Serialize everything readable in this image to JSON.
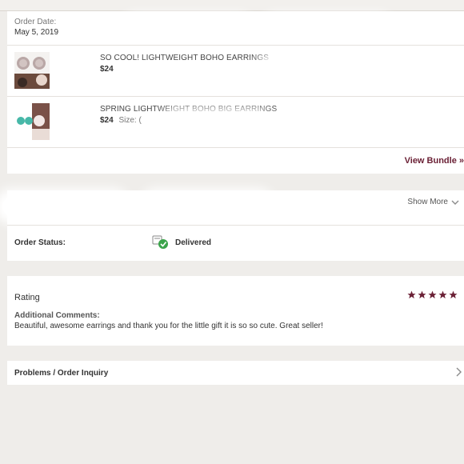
{
  "order": {
    "date_label": "Order Date:",
    "date_value": "May 5, 2019"
  },
  "products": [
    {
      "title": "SO COOL! LIGHTWEIGHT BOHO EARRINGS",
      "price": "$24",
      "extra": ""
    },
    {
      "title": "SPRING LIGHTWEIGHT BOHO BIG EARRINGS",
      "price": "$24",
      "extra": "Size: ("
    }
  ],
  "bundle": {
    "view_label": "View Bundle »"
  },
  "shipping": {
    "show_more": "Show More"
  },
  "status": {
    "label": "Order Status:",
    "value": "Delivered"
  },
  "rating": {
    "title": "Rating",
    "stars": 5,
    "comments_label": "Additional Comments:",
    "comments": "Beautiful, awesome earrings and thank you for the little gift it is so so cute. Great seller!"
  },
  "inquiry": {
    "label": "Problems / Order Inquiry"
  },
  "colors": {
    "accent": "#6b2136",
    "status_green": "#3aa34a"
  }
}
